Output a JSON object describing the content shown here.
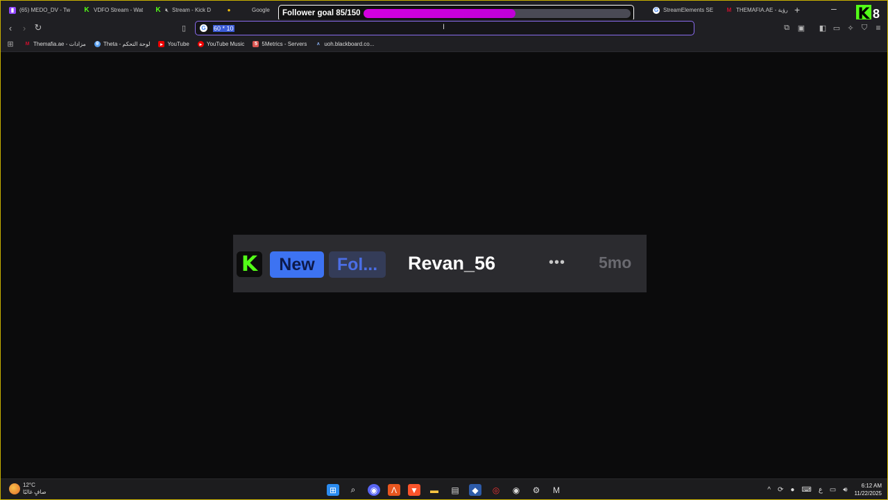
{
  "tabs": [
    {
      "label": "(65) MEDO_DV - Tw",
      "icon": "twitch"
    },
    {
      "label": "VDFO Stream - Wat",
      "icon": "kick"
    },
    {
      "label": "Stream - Kick D",
      "icon": "kick-muted"
    },
    {
      "label": "",
      "icon": "maps"
    },
    {
      "label": "Google",
      "icon": "google"
    },
    {
      "label": "StreamElements SE",
      "icon": "google"
    },
    {
      "label": "THEMAFIA.AE - رؤية",
      "icon": "mafia"
    }
  ],
  "goal": {
    "label": "Follower goal 85/150",
    "current": 85,
    "target": 150,
    "fill_color": "#cc00dd"
  },
  "kick_badge": {
    "count": "8"
  },
  "urlbar": {
    "value": "60 * 10"
  },
  "bookmarks": [
    {
      "label": "Themafia.ae - مزادات",
      "icon": "mafia"
    },
    {
      "label": "Theta - لوحة التحكم",
      "icon": "theta"
    },
    {
      "label": "YouTube",
      "icon": "youtube"
    },
    {
      "label": "YouTube Music",
      "icon": "youtube-music"
    },
    {
      "label": "5Metrics - Servers",
      "icon": "5metrics"
    },
    {
      "label": "uoh.blackboard.co...",
      "icon": "blackboard"
    }
  ],
  "alert": {
    "new_label": "New",
    "follow_label": "Fol...",
    "username": "Revan_56",
    "dots": "•••",
    "time": "5mo",
    "brand_letter": "K"
  },
  "taskbar": {
    "weather_temp": "12°C",
    "weather_desc": "صافٍ غالبًا",
    "time": "6:12 AM",
    "date": "11/22/2025",
    "lang": "ع"
  },
  "colors": {
    "kick_green": "#53fc18",
    "accent_blue": "#3d73f2",
    "url_border": "#8a6cf0"
  }
}
